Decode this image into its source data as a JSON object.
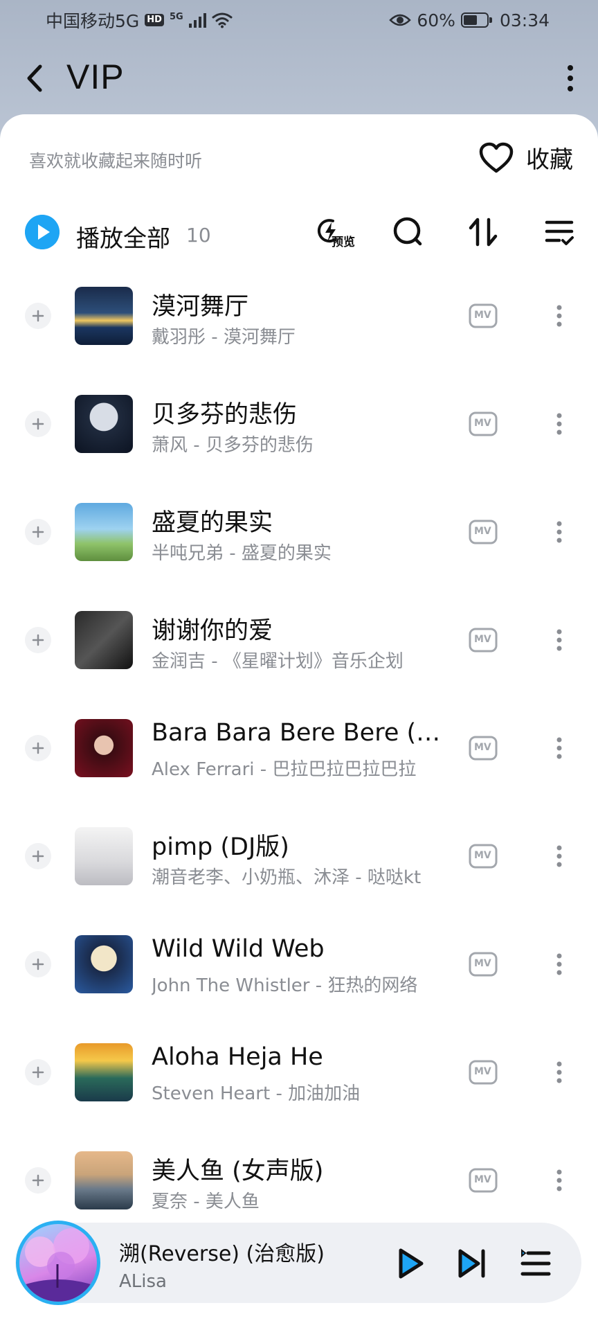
{
  "status_bar": {
    "carrier": "中国移动5G",
    "hd": "HD",
    "network": "5G",
    "battery": "60%",
    "time": "03:34"
  },
  "header": {
    "title": "VIP"
  },
  "favorite": {
    "hint": "喜欢就收藏起来随时听",
    "label": "收藏"
  },
  "toolbar": {
    "play_all_label": "播放全部",
    "count": "10",
    "preview_label": "预览"
  },
  "songs": [
    {
      "title": "漠河舞厅",
      "subtitle": "戴羽彤 - 漠河舞厅"
    },
    {
      "title": "贝多芬的悲伤",
      "subtitle": "萧风 - 贝多芬的悲伤"
    },
    {
      "title": "盛夏的果实",
      "subtitle": "半吨兄弟 - 盛夏的果实"
    },
    {
      "title": "谢谢你的爱",
      "subtitle": "金润吉 - 《星曜计划》音乐企划"
    },
    {
      "title": "Bara Bara Bere Bere (D...",
      "subtitle": "Alex Ferrari - 巴拉巴拉巴拉巴拉"
    },
    {
      "title": "pimp (DJ版)",
      "subtitle": "潮音老李、小奶瓶、沐泽 - 哒哒kt"
    },
    {
      "title": "Wild Wild Web",
      "subtitle": "John The Whistler - 狂热的网络"
    },
    {
      "title": "Aloha Heja He",
      "subtitle": "Steven Heart - 加油加油"
    },
    {
      "title": "美人鱼 (女声版)",
      "subtitle": "夏奈 - 美人鱼"
    }
  ],
  "mv_label": "MV",
  "now_playing": {
    "title": "溯(Reverse) (治愈版)",
    "artist": "ALisa"
  },
  "colors": {
    "accent": "#1ea5f4",
    "secondary_text": "#8a8d93"
  }
}
